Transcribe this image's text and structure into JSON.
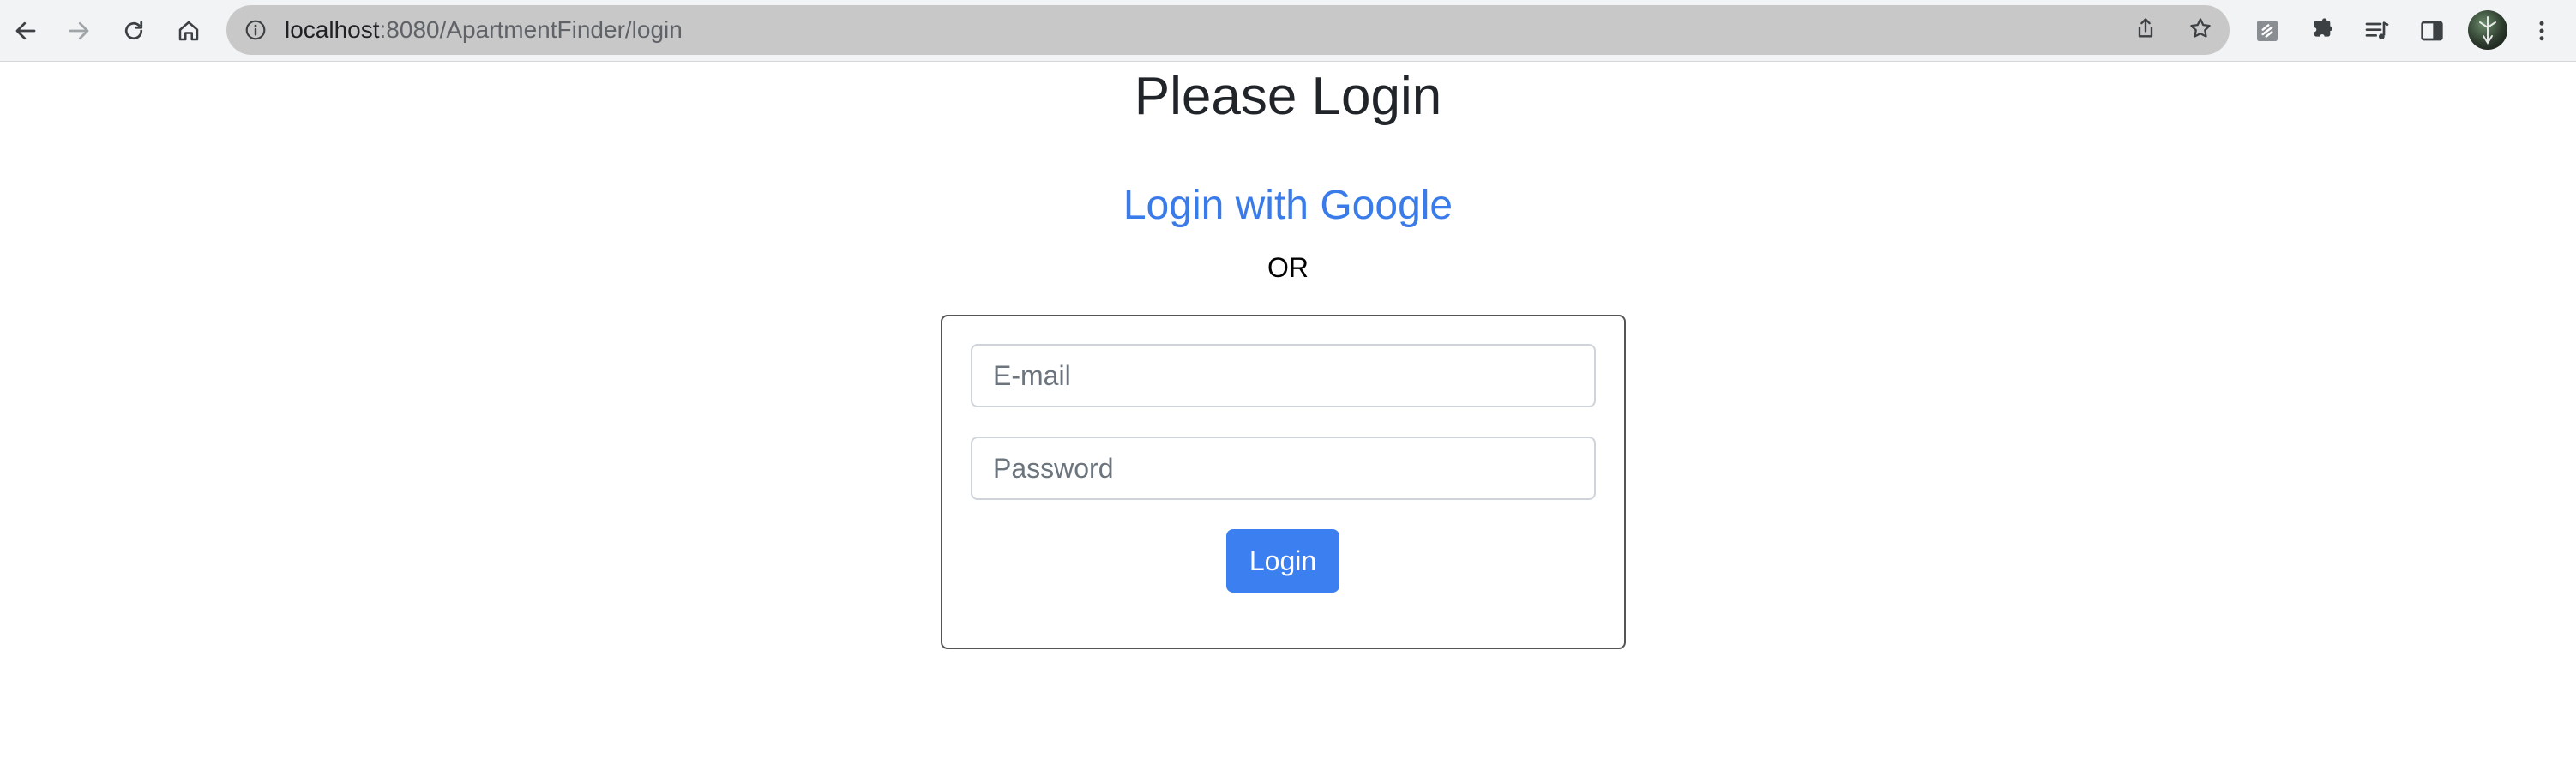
{
  "browser": {
    "url_host": "localhost",
    "url_path": ":8080/ApartmentFinder/login",
    "icons": {
      "back": "arrow-left-icon",
      "forward": "arrow-right-icon",
      "reload": "reload-icon",
      "home": "home-icon",
      "site_info": "info-icon",
      "share": "share-icon",
      "bookmark": "star-icon",
      "extension": "extension-icon",
      "puzzle": "puzzle-icon",
      "media": "media-control-icon",
      "side_panel": "side-panel-icon",
      "menu": "kebab-menu-icon"
    }
  },
  "page": {
    "title": "Please Login",
    "google_link": "Login with Google",
    "or_text": "OR"
  },
  "form": {
    "email_placeholder": "E-mail",
    "email_value": "",
    "password_placeholder": "Password",
    "password_value": "",
    "submit_label": "Login"
  },
  "colors": {
    "link": "#3a7bea",
    "button": "#3b7ff0",
    "omnibox": "#c8c8c8"
  }
}
